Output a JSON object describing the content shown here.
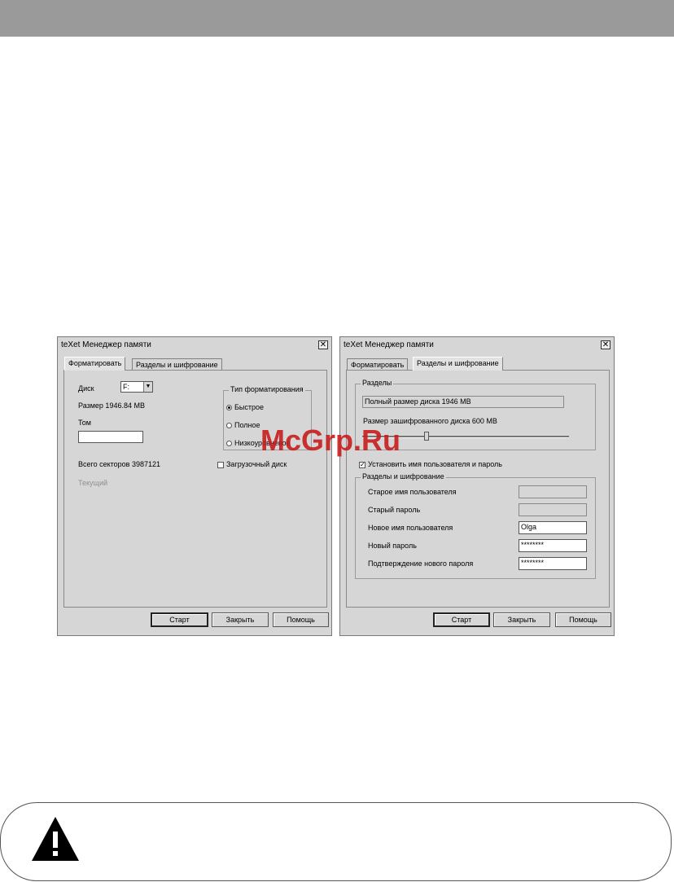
{
  "watermark": "McGrp.Ru",
  "left_window": {
    "title": "teXet Менеджер памяти",
    "close_label": "✕",
    "tabs": [
      "Форматировать",
      "Разделы и шифрование"
    ],
    "disk_label": "Диск",
    "disk_value": "F:",
    "size_text": "Размер 1946.84 MB",
    "volume_label": "Том",
    "volume_value": "",
    "format_type_legend": "Тип форматирования",
    "format_options": [
      "Быстрое",
      "Полное",
      "Низкоуровневое"
    ],
    "format_selected": "Быстрое",
    "total_sectors": "Всего секторов 3987121",
    "boot_disk_label": "Загрузочный диск",
    "current_label": "Текущий",
    "buttons": [
      "Старт",
      "Закрыть",
      "Помощь"
    ]
  },
  "right_window": {
    "title": "teXet Менеджер памяти",
    "close_label": "✕",
    "tabs": [
      "Форматировать",
      "Разделы и шифрование"
    ],
    "partitions_legend": "Разделы",
    "full_size_text": "Полный размер диска 1946 MB",
    "encrypted_size_label": "Размер зашифрованного диска 600 MB",
    "encrypted_slider_fraction": 0.31,
    "set_user_label": "Установить имя пользователя и пароль",
    "set_user_checked": true,
    "credentials_legend": "Разделы и шифрование",
    "old_username_label": "Старое имя пользователя",
    "old_password_label": "Старый пароль",
    "new_username_label": "Новое имя пользователя",
    "new_username_value": "Olga",
    "new_password_label": "Новый пароль",
    "new_password_value": "********",
    "confirm_password_label": "Подтверждение нового пароля",
    "confirm_password_value": "********",
    "buttons": [
      "Старт",
      "Закрыть",
      "Помощь"
    ]
  }
}
